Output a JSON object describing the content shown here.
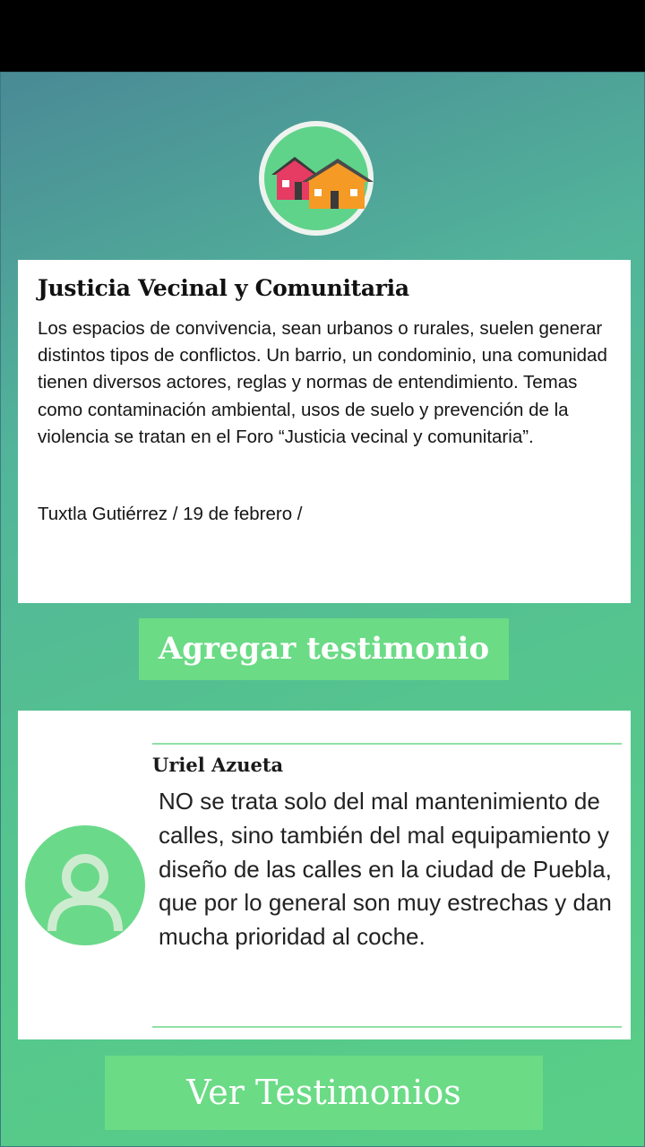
{
  "forum": {
    "title": "Justicia Vecinal y Comunitaria",
    "description": "Los espacios de convivencia, sean urbanos o rurales, suelen generar distintos tipos de conflictos. Un barrio, un condominio, una comunidad tienen diversos actores, reglas y normas de entendimiento. Temas como contaminación ambiental, usos de suelo y prevención de la violencia se tratan en el Foro “Justicia vecinal y comunitaria”.",
    "location_date": "Tuxtla Gutiérrez / 19 de febrero /"
  },
  "actions": {
    "add_testimony": "Agregar testimonio",
    "view_testimonies": "Ver Testimonios"
  },
  "testimony": {
    "author": "Uriel Azueta",
    "text": "NO se trata solo del mal mantenimiento de calles, sino también del mal equipamiento y diseño de las calles en la ciudad de Puebla, que por lo general son muy estrechas y dan mucha prioridad al coche."
  },
  "icons": {
    "logo": "houses-icon",
    "avatar": "user-avatar-icon"
  },
  "colors": {
    "accent": "#6bdb86",
    "house_red": "#e63b62",
    "house_orange": "#f59a24"
  }
}
